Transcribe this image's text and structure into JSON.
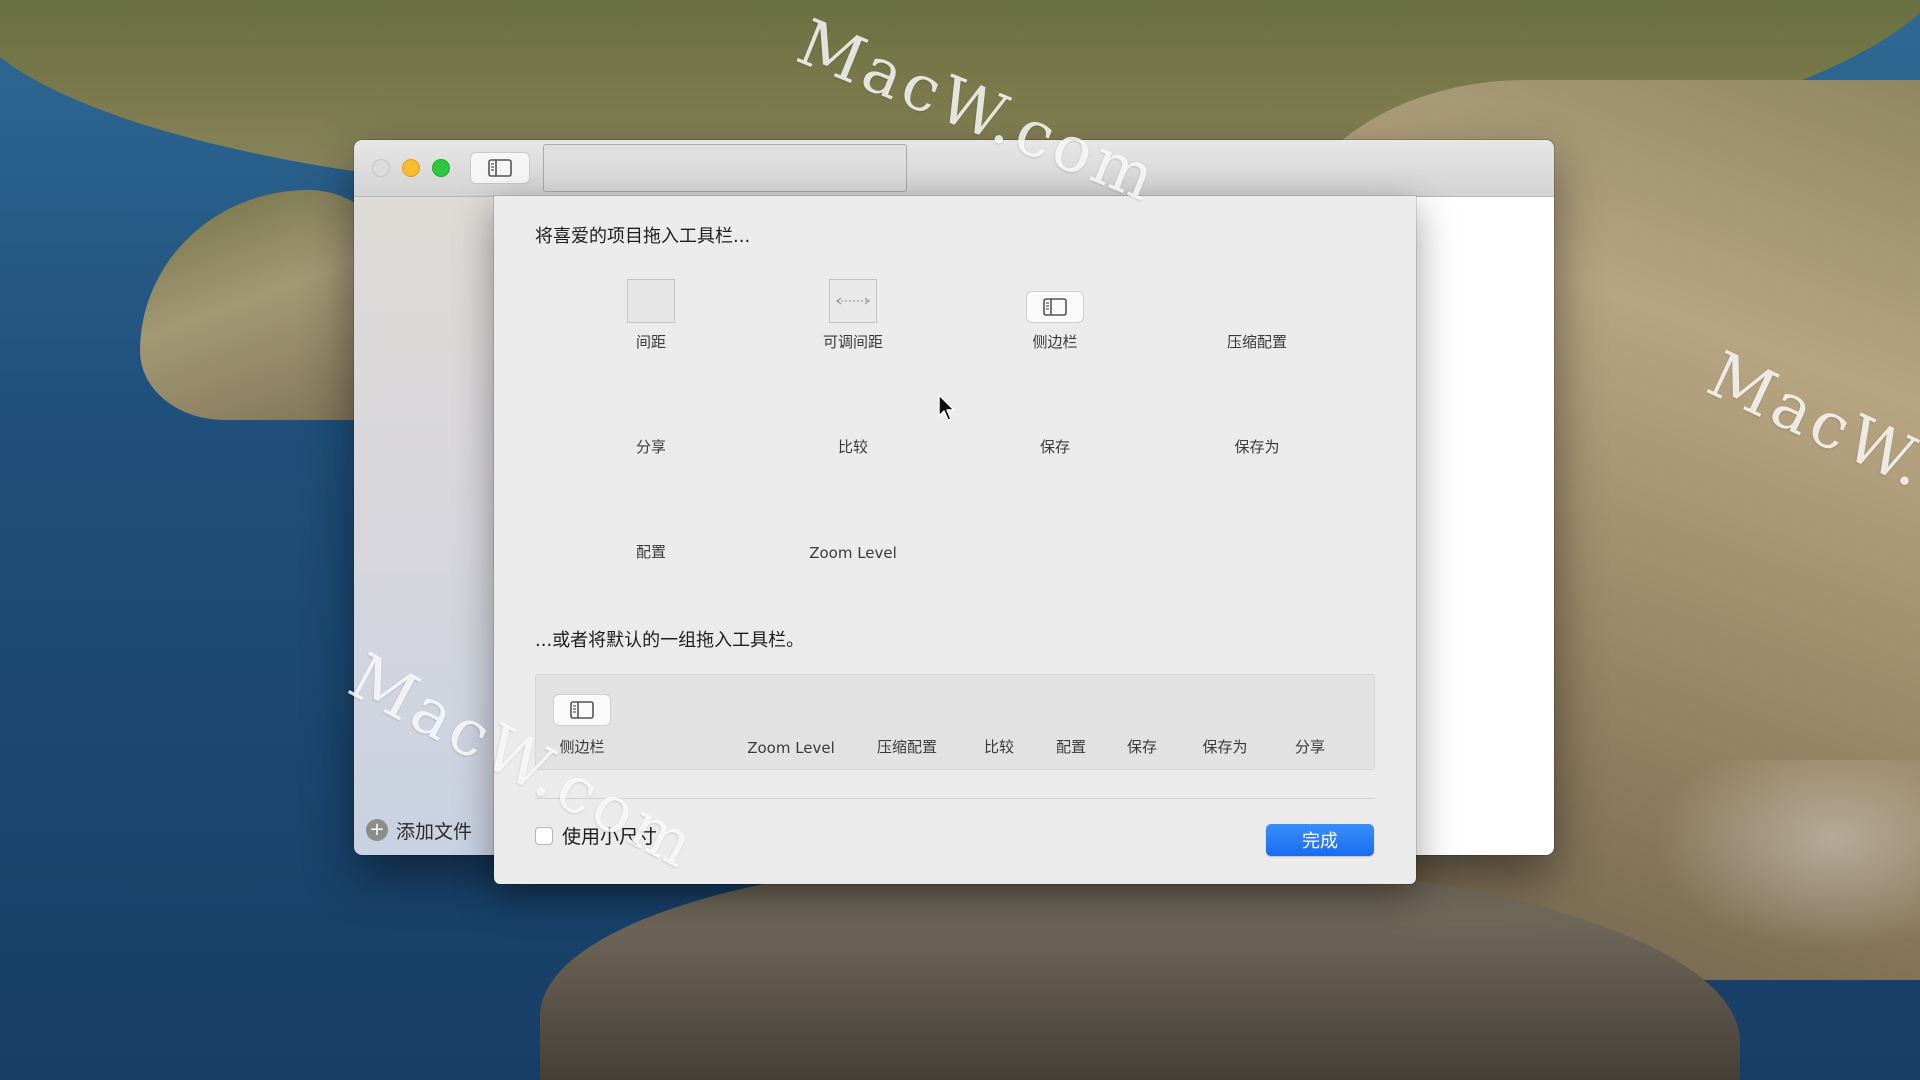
{
  "window": {
    "add_file_label": "添加文件"
  },
  "customize_sheet": {
    "palette_heading": "将喜爱的项目拖入工具栏...",
    "palette_items": [
      {
        "label": "间距",
        "icon": "spacer-icon"
      },
      {
        "label": "可调间距",
        "icon": "flexible-spacer-icon"
      },
      {
        "label": "侧边栏",
        "icon": "sidebar-icon"
      },
      {
        "label": "压缩配置",
        "icon": ""
      },
      {
        "label": "分享",
        "icon": ""
      },
      {
        "label": "比较",
        "icon": ""
      },
      {
        "label": "保存",
        "icon": ""
      },
      {
        "label": "保存为",
        "icon": ""
      },
      {
        "label": "配置",
        "icon": ""
      },
      {
        "label": "Zoom Level",
        "icon": ""
      }
    ],
    "default_heading": "...或者将默认的一组拖入工具栏。",
    "default_set": [
      {
        "label": "侧边栏",
        "icon": "sidebar-icon"
      },
      {
        "label": "Zoom Level"
      },
      {
        "label": "压缩配置"
      },
      {
        "label": "比较"
      },
      {
        "label": "配置"
      },
      {
        "label": "保存"
      },
      {
        "label": "保存为"
      },
      {
        "label": "分享"
      }
    ],
    "small_size_label": "使用小尺寸",
    "small_size_checked": false,
    "done_label": "完成"
  },
  "watermarks": [
    "MacW.com",
    "MacW.com",
    "MacW.com"
  ],
  "colors": {
    "accent": "#1a6cf0",
    "traffic_close": "#dcdcdc",
    "traffic_minimize": "#f6be2f",
    "traffic_zoom": "#2dc840"
  }
}
